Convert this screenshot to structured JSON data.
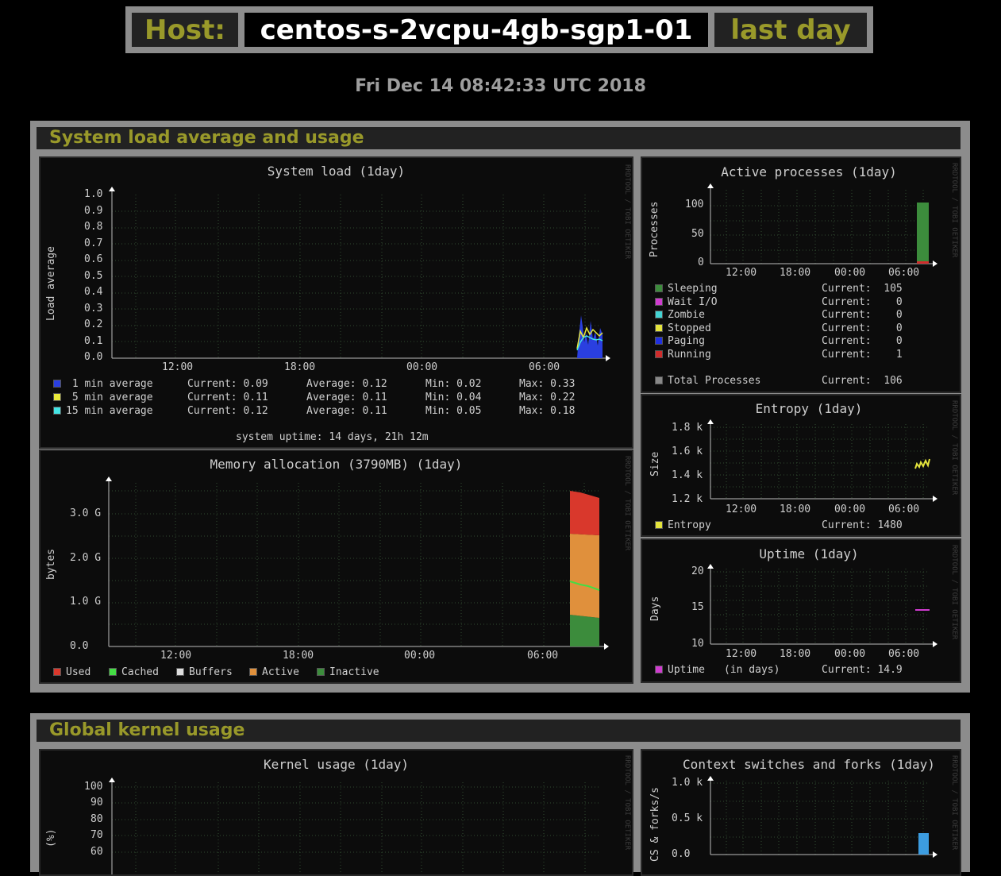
{
  "header": {
    "host_label": "Host:",
    "host_name": "centos-s-2vcpu-4gb-sgp1-01",
    "range_label": "last day"
  },
  "datetime": "Fri Dec 14 08:42:33 UTC 2018",
  "sections": [
    {
      "title": "System load average and usage"
    },
    {
      "title": "Global kernel usage"
    }
  ],
  "watermark": "RRDTOOL / TOBI OETIKER",
  "x_ticks": [
    "12:00",
    "18:00",
    "00:00",
    "06:00"
  ],
  "load": {
    "title": "System load   (1day)",
    "ylabel": "Load average",
    "yticks": [
      "1.0",
      "0.9",
      "0.8",
      "0.7",
      "0.6",
      "0.5",
      "0.4",
      "0.3",
      "0.2",
      "0.1",
      "0.0"
    ],
    "legend": [
      {
        "label": " 1 min average",
        "current": "Current: 0.09",
        "average": "Average: 0.12",
        "min": "Min: 0.02",
        "max": "Max: 0.33",
        "color": "#2a3fe0"
      },
      {
        "label": " 5 min average",
        "current": "Current: 0.11",
        "average": "Average: 0.11",
        "min": "Min: 0.04",
        "max": "Max: 0.22",
        "color": "#e8e83a"
      },
      {
        "label": "15 min average",
        "current": "Current: 0.12",
        "average": "Average: 0.11",
        "min": "Min: 0.05",
        "max": "Max: 0.18",
        "color": "#44e4e4"
      }
    ],
    "uptime_text": "system uptime: 14 days, 21h 12m"
  },
  "memory": {
    "title": "Memory allocation (3790MB)  (1day)",
    "ylabel": "bytes",
    "yticks": [
      "3.0 G",
      "2.0 G",
      "1.0 G",
      "0.0"
    ],
    "legend": [
      {
        "label": "Used",
        "color": "#d9382c"
      },
      {
        "label": "Cached",
        "color": "#44dd44"
      },
      {
        "label": "Buffers",
        "color": "#dddddd"
      },
      {
        "label": "Active",
        "color": "#e0903c"
      },
      {
        "label": "Inactive",
        "color": "#3c8c3c"
      }
    ]
  },
  "processes": {
    "title": "Active processes  (1day)",
    "ylabel": "Processes",
    "yticks": [
      "100",
      "50",
      "0"
    ],
    "legend": [
      {
        "label": "Sleeping",
        "current": "Current:  105",
        "color": "#3c8c3c"
      },
      {
        "label": "Wait I/O",
        "current": "Current:    0",
        "color": "#d03cd0"
      },
      {
        "label": "Zombie",
        "current": "Current:    0",
        "color": "#44d4d4"
      },
      {
        "label": "Stopped",
        "current": "Current:    0",
        "color": "#e4e43c"
      },
      {
        "label": "Paging",
        "current": "Current:    0",
        "color": "#2030e0"
      },
      {
        "label": "Running",
        "current": "Current:    1",
        "color": "#d02c2c"
      }
    ],
    "total": {
      "label": "Total Processes",
      "current": "Current:  106",
      "color": "#888888"
    }
  },
  "entropy": {
    "title": "Entropy  (1day)",
    "ylabel": "Size",
    "yticks": [
      "1.8 k",
      "1.6 k",
      "1.4 k",
      "1.2 k"
    ],
    "legend": {
      "label": "Entropy",
      "current": "Current: 1480",
      "color": "#e4e43c"
    }
  },
  "uptime": {
    "title": "Uptime  (1day)",
    "ylabel": "Days",
    "yticks": [
      "20",
      "15",
      "10"
    ],
    "legend": {
      "label": "Uptime",
      "unit": "(in days)",
      "current": "Current: 14.9",
      "color": "#d03cd0"
    }
  },
  "kernel": {
    "title": "Kernel usage  (1day)",
    "ylabel": "(%)",
    "yticks": [
      "100",
      "90",
      "80",
      "70",
      "60"
    ]
  },
  "context": {
    "title": "Context switches and forks  (1day)",
    "ylabel": "CS & forks/s",
    "yticks": [
      "1.0 k",
      "0.5 k",
      "0.0"
    ]
  }
}
